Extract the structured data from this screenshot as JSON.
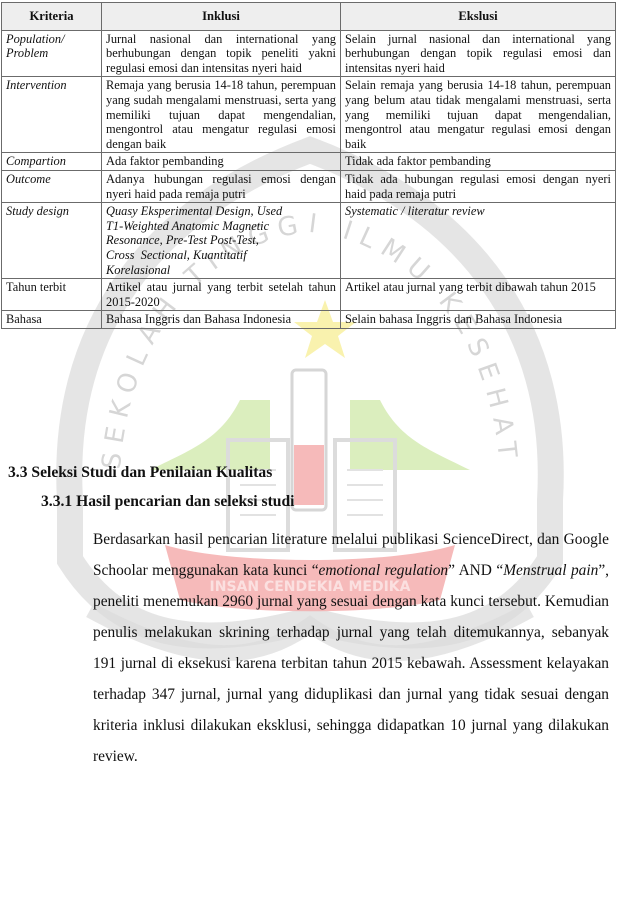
{
  "table": {
    "headers": [
      "Kriteria",
      "Inklusi",
      "Ekslusi"
    ],
    "rows": [
      {
        "criterion": "Population/ Problem",
        "criterion_italic": true,
        "inclusion": "Jurnal nasional dan international yang berhubungan dengan topik peneliti yakni regulasi emosi dan intensitas nyeri haid",
        "inclusion_italic": false,
        "exclusion": "Selain jurnal nasional dan international yang berhubungan dengan topik regulasi emosi dan intensitas nyeri haid",
        "exclusion_italic": false
      },
      {
        "criterion": "Intervention",
        "criterion_italic": true,
        "inclusion": "Remaja yang berusia 14-18 tahun, perempuan yang sudah mengalami menstruasi, serta yang memiliki tujuan dapat mengendalian, mengontrol atau mengatur regulasi emosi dengan baik",
        "inclusion_italic": false,
        "exclusion": "Selain remaja yang berusia 14-18 tahun, perempuan yang belum atau tidak mengalami menstruasi, serta yang memiliki tujuan dapat mengendalian, mengontrol atau mengatur regulasi emosi dengan baik",
        "exclusion_italic": false
      },
      {
        "criterion": "Compartion",
        "criterion_italic": true,
        "inclusion": "Ada faktor pembanding",
        "inclusion_italic": false,
        "exclusion": "Tidak ada faktor pembanding",
        "exclusion_italic": false
      },
      {
        "criterion": "Outcome",
        "criterion_italic": true,
        "inclusion": "Adanya hubungan regulasi emosi dengan nyeri haid pada remaja putri",
        "inclusion_italic": false,
        "exclusion": "Tidak ada hubungan regulasi emosi dengan nyeri haid pada remaja putri",
        "exclusion_italic": false
      },
      {
        "criterion": "Study design",
        "criterion_italic": true,
        "inclusion_lines": [
          "Quasy Eksperimental Design, Used",
          "T1-Weighted Anatomic Magnetic",
          "Resonance, Pre-Test Post-Test,",
          "Cross  Sectional, Kuantitatif",
          "Korelasional"
        ],
        "inclusion_italic": true,
        "exclusion": "Systematic / literatur review",
        "exclusion_italic": true
      },
      {
        "criterion": "Tahun terbit",
        "criterion_italic": false,
        "inclusion": "Artikel atau jurnal yang terbit setelah tahun 2015-2020",
        "inclusion_italic": false,
        "exclusion": "Artikel atau jurnal yang terbit dibawah tahun 2015",
        "exclusion_italic": false
      },
      {
        "criterion": "Bahasa",
        "criterion_italic": false,
        "inclusion": "Bahasa Inggris dan Bahasa Indonesia",
        "inclusion_italic": false,
        "exclusion": "Selain bahasa Inggris dan Bahasa Indonesia",
        "exclusion_italic": false
      }
    ]
  },
  "section": {
    "heading": "3.3 Seleksi Studi dan Penilaian Kualitas",
    "subheading": "3.3.1 Hasil pencarian dan seleksi studi",
    "paragraph": {
      "part1": "Berdasarkan hasil pencarian literature melalui publikasi ScienceDirect, dan Google Schoolar menggunakan kata kunci “",
      "keyword1": "emotional regulation",
      "part2": "” AND “",
      "keyword2": "Menstrual pain",
      "part3": "”, peneliti menemukan 2960 jurnal yang sesuai dengan kata kunci tersebut. Kemudian penulis melakukan skrining terhadap jurnal yang telah ditemukannya, sebanyak 191 jurnal di eksekusi karena terbitan tahun 2015 kebawah. Assessment kelayakan terhadap 347 jurnal, jurnal yang diduplikasi dan jurnal yang tidak sesuai dengan kriteria inklusi dilakukan eksklusi, sehingga didapatkan 10 jurnal yang dilakukan review."
    }
  },
  "watermark": {
    "arc_text": "SEKOLAH TINGGI ILMU KESEHATAN",
    "banner_text": "INSAN CENDEKIA MEDIKA",
    "colors": {
      "gray": "#d9d9d9",
      "green": "#c8e6a0",
      "red": "#f2a0a0",
      "star": "#f7ef9a"
    }
  }
}
